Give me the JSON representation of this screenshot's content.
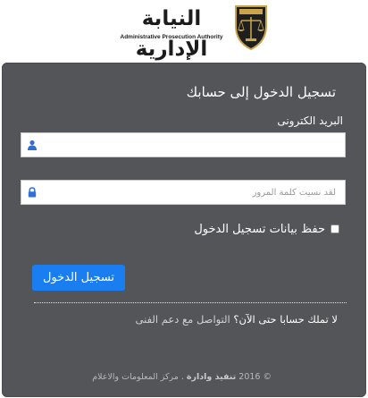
{
  "header": {
    "logo_ar": "النيابة الإدارية",
    "logo_en": "Administrative Prosecution Authority",
    "emblem_text": "النيابة الإدارية"
  },
  "form": {
    "title": "تسجيل الدخول إلى حسابك",
    "email_label": "البريد الكترونى",
    "email_value": "",
    "password_placeholder": "لقد نسيت كلمة المرور",
    "remember_label": "حفظ بيانات تسجيل الدخول",
    "remember_checked": false,
    "login_button": "تسجيل الدخول",
    "signup_question": "لا تملك حسابا حتى الآن؟",
    "signup_link": "التواصل مع دعم الفنى"
  },
  "footer": {
    "copyright": "© 2016",
    "org": "تنفيذ وادارة",
    "dept": ". مركز المعلومات والاعلام"
  },
  "colors": {
    "panel_bg": "#545559",
    "button_bg": "#1a7ef0",
    "icon_blue": "#2f6fd6"
  },
  "icons": {
    "email_field": "user-icon",
    "password_field": "lock-icon",
    "emblem": "scales-of-justice-icon"
  }
}
